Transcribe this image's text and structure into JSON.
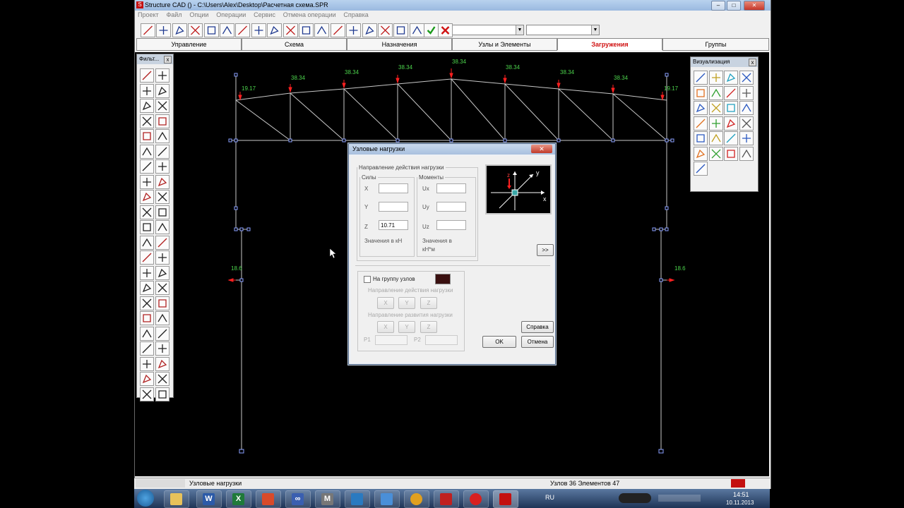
{
  "window": {
    "title": "Structure CAD () - C:\\Users\\Alex\\Desktop\\Расчетная схема.SPR",
    "app_icon": "S"
  },
  "menu": [
    "Проект",
    "Файл",
    "Опции",
    "Операции",
    "Сервис",
    "Отмена операции",
    "Справка"
  ],
  "tabs": [
    {
      "label": "Управление"
    },
    {
      "label": "Схема"
    },
    {
      "label": "Назначения"
    },
    {
      "label": "Узлы и Элементы"
    },
    {
      "label": "Загружения",
      "active": true
    },
    {
      "label": "Группы"
    }
  ],
  "palette": {
    "title": "Фильт...",
    "close": "x"
  },
  "visualization": {
    "title": "Визуализация",
    "close": "x"
  },
  "model_labels": {
    "top_loads": [
      "19.17",
      "38.34",
      "38.34",
      "38.34",
      "38.34",
      "38.34",
      "38.34",
      "38.34",
      "19.17"
    ],
    "side_load_left": "18.6",
    "side_load_right": "18.6"
  },
  "dialog": {
    "title": "Узловые нагрузки",
    "direction_group": "Направление действия нагрузки",
    "forces_group": "Силы",
    "moments_group": "Моменты",
    "x_label": "X",
    "y_label": "Y",
    "z_label": "Z",
    "ux_label": "Ux",
    "uy_label": "Uy",
    "uz_label": "Uz",
    "x_value": "",
    "y_value": "",
    "z_value": "10.71",
    "ux_value": "",
    "uy_value": "",
    "uz_value": "",
    "forces_units": "Значения в кН",
    "moments_units": "Значения в кН*м",
    "expand_button": ">>",
    "group_checkbox_label": "На группу узлов",
    "group_direction_label": "Направление действия нагрузки",
    "group_distribution_label": "Направление развития нагрузки",
    "axis_x": "X",
    "axis_y": "Y",
    "axis_z": "Z",
    "p1_label": "P1",
    "p2_label": "P2",
    "help_button": "Справка",
    "ok_button": "OK",
    "cancel_button": "Отмена",
    "preview_axis_y": "y",
    "preview_axis_x": "x",
    "preview_axis_z": "z"
  },
  "status": {
    "left": "Узловые нагрузки",
    "right": "Узлов 36 Элементов 47"
  },
  "taskbar": {
    "lang": "RU",
    "time": "14:51",
    "date": "10.11.2013"
  }
}
